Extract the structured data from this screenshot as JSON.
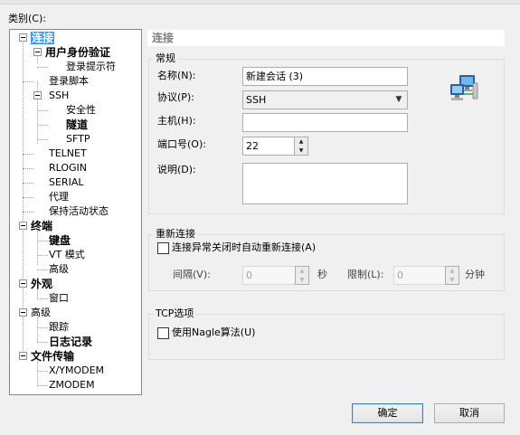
{
  "category_label": "类别(C):",
  "tree": {
    "items": [
      {
        "label": "连接"
      },
      {
        "label": "用户身份验证"
      },
      {
        "label": "登录提示符"
      },
      {
        "label": "登录脚本"
      },
      {
        "label": "SSH"
      },
      {
        "label": "安全性"
      },
      {
        "label": "隧道"
      },
      {
        "label": "SFTP"
      },
      {
        "label": "TELNET"
      },
      {
        "label": "RLOGIN"
      },
      {
        "label": "SERIAL"
      },
      {
        "label": "代理"
      },
      {
        "label": "保持活动状态"
      },
      {
        "label": "终端"
      },
      {
        "label": "键盘"
      },
      {
        "label": "VT 模式"
      },
      {
        "label": "高级"
      },
      {
        "label": "外观"
      },
      {
        "label": "窗口"
      },
      {
        "label": "高级"
      },
      {
        "label": "跟踪"
      },
      {
        "label": "日志记录"
      },
      {
        "label": "文件传输"
      },
      {
        "label": "X/YMODEM"
      },
      {
        "label": "ZMODEM"
      }
    ],
    "selected": "连接"
  },
  "panel": {
    "header": "连接",
    "general": {
      "title": "常规",
      "name_label": "名称(N):",
      "name_value": "新建会话 (3)",
      "protocol_label": "协议(P):",
      "protocol_value": "SSH",
      "host_label": "主机(H):",
      "host_value": "",
      "port_label": "端口号(O):",
      "port_value": "22",
      "desc_label": "说明(D):",
      "desc_value": ""
    },
    "reconnect": {
      "title": "重新连接",
      "checkbox_label": "连接异常关闭时自动重新连接(A)",
      "checked": false,
      "interval_label": "间隔(V):",
      "interval_value": "0",
      "interval_unit": "秒",
      "limit_label": "限制(L):",
      "limit_value": "0",
      "limit_unit": "分钟"
    },
    "tcp": {
      "title": "TCP选项",
      "nagle_label": "使用Nagle算法(U)",
      "checked": false
    }
  },
  "buttons": {
    "ok": "确定",
    "cancel": "取消"
  },
  "icons": {
    "connection": "network-computers-icon"
  }
}
